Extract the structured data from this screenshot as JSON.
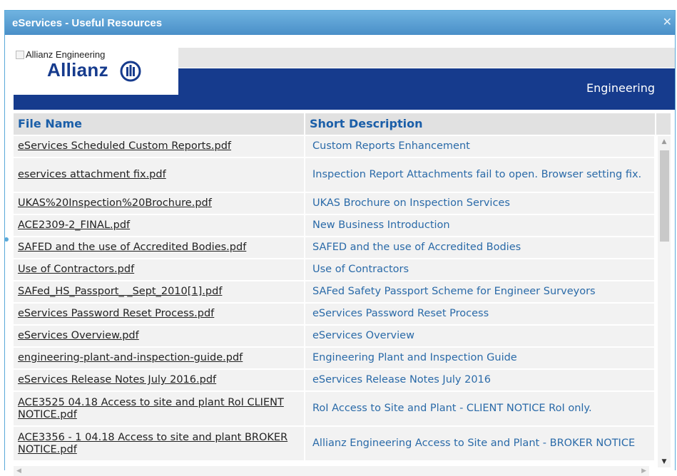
{
  "dialog": {
    "title": "eServices - Useful Resources",
    "close_icon": "close-icon"
  },
  "banner": {
    "logo_alt": "Allianz Engineering",
    "logo_word": "Allianz",
    "label": "Engineering"
  },
  "table": {
    "headers": [
      "File Name",
      "Short Description"
    ],
    "rows": [
      {
        "file": "eServices Scheduled Custom Reports.pdf",
        "desc": "Custom Reports Enhancement"
      },
      {
        "file": "eservices attachment fix.pdf",
        "desc": "Inspection Report Attachments fail to open. Browser setting fix."
      },
      {
        "file": "UKAS%20Inspection%20Brochure.pdf",
        "desc": "UKAS Brochure on Inspection Services"
      },
      {
        "file": "ACE2309-2_FINAL.pdf",
        "desc": "New Business Introduction"
      },
      {
        "file": "SAFED and the use of Accredited Bodies.pdf",
        "desc": "SAFED and the use of Accredited Bodies"
      },
      {
        "file": "Use of Contractors.pdf",
        "desc": "Use of Contractors"
      },
      {
        "file": "SAFed_HS_Passport_ _Sept_2010[1].pdf",
        "desc": "SAFed Safety Passport Scheme for Engineer Surveyors"
      },
      {
        "file": "eServices Password Reset Process.pdf",
        "desc": "eServices Password Reset Process"
      },
      {
        "file": "eServices Overview.pdf",
        "desc": "eServices Overview"
      },
      {
        "file": "engineering-plant-and-inspection-guide.pdf",
        "desc": "Engineering Plant and Inspection Guide"
      },
      {
        "file": "eServices Release Notes July 2016.pdf",
        "desc": "eServices Release Notes July 2016"
      },
      {
        "file": "ACE3525 04.18 Access to site and plant RoI CLIENT NOTICE.pdf",
        "desc": "RoI Access to Site and Plant - CLIENT NOTICE RoI only."
      },
      {
        "file": "ACE3356 - 1 04.18 Access to site and plant BROKER NOTICE.pdf",
        "desc": "Allianz Engineering Access to Site and Plant - BROKER NOTICE"
      }
    ],
    "row_heights_lines": [
      1,
      2,
      1,
      1,
      1,
      1,
      1,
      1,
      1,
      1,
      1,
      2,
      2
    ]
  },
  "colors": {
    "banner": "#163b8d",
    "titlebar": "#4a8fc8",
    "header_text": "#1a5ea8",
    "desc_text": "#2a6aa8"
  }
}
